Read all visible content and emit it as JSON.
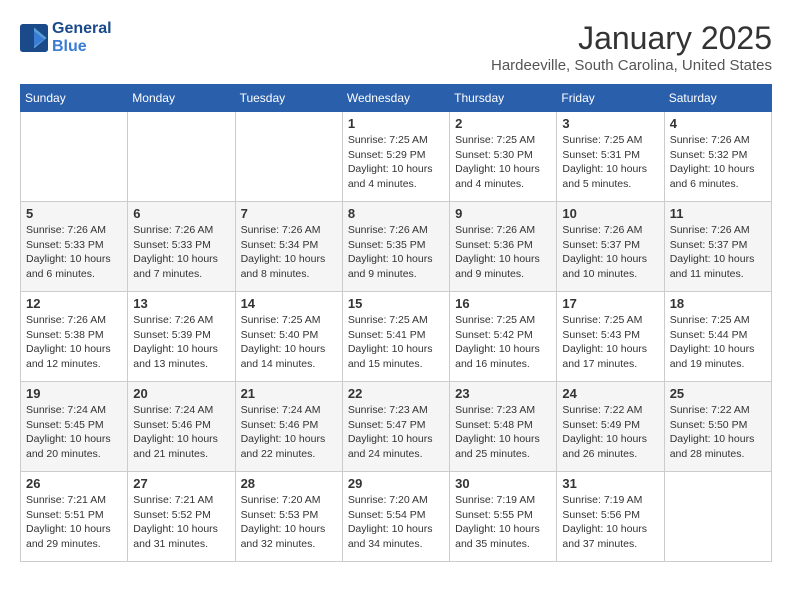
{
  "logo": {
    "line1": "General",
    "line2": "Blue"
  },
  "title": "January 2025",
  "subtitle": "Hardeeville, South Carolina, United States",
  "days_of_week": [
    "Sunday",
    "Monday",
    "Tuesday",
    "Wednesday",
    "Thursday",
    "Friday",
    "Saturday"
  ],
  "weeks": [
    [
      {
        "day": "",
        "info": ""
      },
      {
        "day": "",
        "info": ""
      },
      {
        "day": "",
        "info": ""
      },
      {
        "day": "1",
        "info": "Sunrise: 7:25 AM\nSunset: 5:29 PM\nDaylight: 10 hours\nand 4 minutes."
      },
      {
        "day": "2",
        "info": "Sunrise: 7:25 AM\nSunset: 5:30 PM\nDaylight: 10 hours\nand 4 minutes."
      },
      {
        "day": "3",
        "info": "Sunrise: 7:25 AM\nSunset: 5:31 PM\nDaylight: 10 hours\nand 5 minutes."
      },
      {
        "day": "4",
        "info": "Sunrise: 7:26 AM\nSunset: 5:32 PM\nDaylight: 10 hours\nand 6 minutes."
      }
    ],
    [
      {
        "day": "5",
        "info": "Sunrise: 7:26 AM\nSunset: 5:33 PM\nDaylight: 10 hours\nand 6 minutes."
      },
      {
        "day": "6",
        "info": "Sunrise: 7:26 AM\nSunset: 5:33 PM\nDaylight: 10 hours\nand 7 minutes."
      },
      {
        "day": "7",
        "info": "Sunrise: 7:26 AM\nSunset: 5:34 PM\nDaylight: 10 hours\nand 8 minutes."
      },
      {
        "day": "8",
        "info": "Sunrise: 7:26 AM\nSunset: 5:35 PM\nDaylight: 10 hours\nand 9 minutes."
      },
      {
        "day": "9",
        "info": "Sunrise: 7:26 AM\nSunset: 5:36 PM\nDaylight: 10 hours\nand 9 minutes."
      },
      {
        "day": "10",
        "info": "Sunrise: 7:26 AM\nSunset: 5:37 PM\nDaylight: 10 hours\nand 10 minutes."
      },
      {
        "day": "11",
        "info": "Sunrise: 7:26 AM\nSunset: 5:37 PM\nDaylight: 10 hours\nand 11 minutes."
      }
    ],
    [
      {
        "day": "12",
        "info": "Sunrise: 7:26 AM\nSunset: 5:38 PM\nDaylight: 10 hours\nand 12 minutes."
      },
      {
        "day": "13",
        "info": "Sunrise: 7:26 AM\nSunset: 5:39 PM\nDaylight: 10 hours\nand 13 minutes."
      },
      {
        "day": "14",
        "info": "Sunrise: 7:25 AM\nSunset: 5:40 PM\nDaylight: 10 hours\nand 14 minutes."
      },
      {
        "day": "15",
        "info": "Sunrise: 7:25 AM\nSunset: 5:41 PM\nDaylight: 10 hours\nand 15 minutes."
      },
      {
        "day": "16",
        "info": "Sunrise: 7:25 AM\nSunset: 5:42 PM\nDaylight: 10 hours\nand 16 minutes."
      },
      {
        "day": "17",
        "info": "Sunrise: 7:25 AM\nSunset: 5:43 PM\nDaylight: 10 hours\nand 17 minutes."
      },
      {
        "day": "18",
        "info": "Sunrise: 7:25 AM\nSunset: 5:44 PM\nDaylight: 10 hours\nand 19 minutes."
      }
    ],
    [
      {
        "day": "19",
        "info": "Sunrise: 7:24 AM\nSunset: 5:45 PM\nDaylight: 10 hours\nand 20 minutes."
      },
      {
        "day": "20",
        "info": "Sunrise: 7:24 AM\nSunset: 5:46 PM\nDaylight: 10 hours\nand 21 minutes."
      },
      {
        "day": "21",
        "info": "Sunrise: 7:24 AM\nSunset: 5:46 PM\nDaylight: 10 hours\nand 22 minutes."
      },
      {
        "day": "22",
        "info": "Sunrise: 7:23 AM\nSunset: 5:47 PM\nDaylight: 10 hours\nand 24 minutes."
      },
      {
        "day": "23",
        "info": "Sunrise: 7:23 AM\nSunset: 5:48 PM\nDaylight: 10 hours\nand 25 minutes."
      },
      {
        "day": "24",
        "info": "Sunrise: 7:22 AM\nSunset: 5:49 PM\nDaylight: 10 hours\nand 26 minutes."
      },
      {
        "day": "25",
        "info": "Sunrise: 7:22 AM\nSunset: 5:50 PM\nDaylight: 10 hours\nand 28 minutes."
      }
    ],
    [
      {
        "day": "26",
        "info": "Sunrise: 7:21 AM\nSunset: 5:51 PM\nDaylight: 10 hours\nand 29 minutes."
      },
      {
        "day": "27",
        "info": "Sunrise: 7:21 AM\nSunset: 5:52 PM\nDaylight: 10 hours\nand 31 minutes."
      },
      {
        "day": "28",
        "info": "Sunrise: 7:20 AM\nSunset: 5:53 PM\nDaylight: 10 hours\nand 32 minutes."
      },
      {
        "day": "29",
        "info": "Sunrise: 7:20 AM\nSunset: 5:54 PM\nDaylight: 10 hours\nand 34 minutes."
      },
      {
        "day": "30",
        "info": "Sunrise: 7:19 AM\nSunset: 5:55 PM\nDaylight: 10 hours\nand 35 minutes."
      },
      {
        "day": "31",
        "info": "Sunrise: 7:19 AM\nSunset: 5:56 PM\nDaylight: 10 hours\nand 37 minutes."
      },
      {
        "day": "",
        "info": ""
      }
    ]
  ]
}
